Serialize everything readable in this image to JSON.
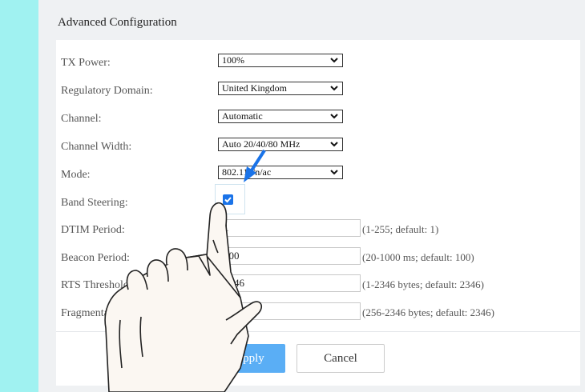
{
  "section": {
    "title": "Advanced Configuration"
  },
  "fields": {
    "tx_power": {
      "label": "TX Power:",
      "value": "100%"
    },
    "regulatory_domain": {
      "label": "Regulatory Domain:",
      "value": "United Kingdom"
    },
    "channel": {
      "label": "Channel:",
      "value": "Automatic"
    },
    "channel_width": {
      "label": "Channel Width:",
      "value": "Auto 20/40/80 MHz"
    },
    "mode": {
      "label": "Mode:",
      "value": "802.11a/n/ac"
    },
    "band_steering": {
      "label": "Band Steering:",
      "checked": true
    },
    "dtim_period": {
      "label": "DTIM Period:",
      "value": "1",
      "hint": "(1-255; default: 1)"
    },
    "beacon_period": {
      "label": "Beacon Period:",
      "value": "100",
      "hint": "(20-1000 ms; default: 100)"
    },
    "rts_threshold": {
      "label": "RTS Threshold:",
      "value": "2346",
      "hint": "(1-2346 bytes; default: 2346)"
    },
    "fragmentation_threshold": {
      "label": "Fragmentation Threshold:",
      "value": "2346",
      "hint": "(256-2346 bytes; default: 2346)"
    }
  },
  "buttons": {
    "apply": "Apply",
    "cancel": "Cancel"
  },
  "colors": {
    "accent": "#1a73e8",
    "apply_button": "#5aaef5",
    "side_stripe": "#a0f2f1"
  },
  "icons": {
    "dropdown": "chevron-down-icon",
    "pointer": "pointing-hand-icon",
    "arrow": "arrow-icon"
  }
}
